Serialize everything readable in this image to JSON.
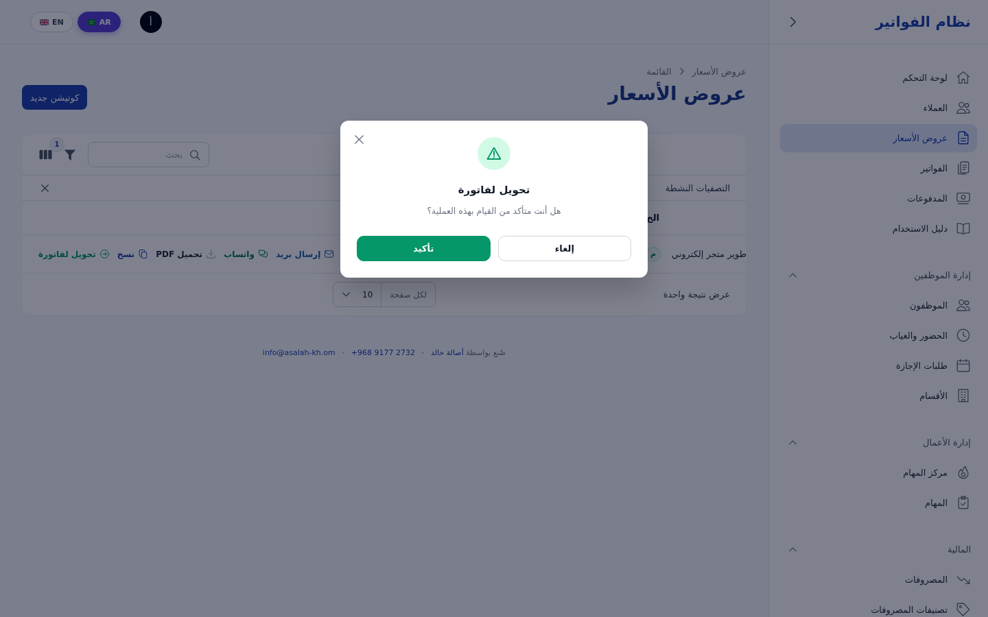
{
  "sidebar": {
    "logo": "نظام الفواتير",
    "nav": [
      {
        "label": "لوحة التحكم",
        "selected": false
      },
      {
        "label": "العملاء",
        "selected": false
      },
      {
        "label": "عروض الأسعار",
        "selected": true
      },
      {
        "label": "الفواتير",
        "selected": false
      },
      {
        "label": "المدفوعات",
        "selected": false
      },
      {
        "label": "دليل الاستخدام",
        "selected": false
      }
    ],
    "groups": [
      {
        "title": "إدارة الموظفين",
        "expanded": true,
        "items": [
          {
            "label": "الموظفون",
            "selected": false
          },
          {
            "label": "الحضور والغياب",
            "selected": false
          },
          {
            "label": "طلبات الإجازة",
            "selected": false
          },
          {
            "label": "الأقسام",
            "selected": false
          }
        ]
      },
      {
        "title": "إدارة الأعمال",
        "expanded": true,
        "items": [
          {
            "label": "مركز المهام",
            "selected": false
          },
          {
            "label": "المهام",
            "selected": false
          }
        ]
      },
      {
        "title": "المالية",
        "expanded": true,
        "items": [
          {
            "label": "المصروفات",
            "selected": false
          },
          {
            "label": "تصنيفات المصروفات",
            "selected": false
          }
        ]
      }
    ]
  },
  "header": {
    "avatar": "أ",
    "languages": [
      {
        "code": "AR",
        "selected": true
      },
      {
        "code": "EN",
        "selected": false
      }
    ]
  },
  "page": {
    "breadcrumb": [
      "عروض الأسعار",
      "القائمة"
    ],
    "title": "عروض الأسعار",
    "new_button": "كوتيشن جديد"
  },
  "table": {
    "search": {
      "placeholder": "بحث"
    },
    "filter_badge": "1",
    "active_filters": {
      "label": "التصفيات النشطة"
    },
    "header_row": {
      "column_2": "الح"
    },
    "rows": [
      {
        "column_1": "طوير متجر إلكتروني",
        "column_2": "م",
        "actions": [
          {
            "label": "إرسال بريد",
            "kind": "email"
          },
          {
            "label": "واتساب",
            "kind": "whatsapp"
          },
          {
            "label": "تحميل PDF",
            "kind": "pdf"
          },
          {
            "label": "نسخ",
            "kind": "copy"
          },
          {
            "label": "تحويل لفاتورة",
            "kind": "convert"
          }
        ]
      }
    ],
    "pagination": {
      "summary": "عرض نتيجة واحدة",
      "per_page_label": "لكل صفحة",
      "per_page": "10"
    }
  },
  "footer": {
    "credit": "صُنع بواسطة",
    "author": "أصالة خالد",
    "phone": "+968 9177 2732",
    "email": "info@asalah-kh.om"
  },
  "dialog": {
    "title": "تحويل لفاتورة",
    "message": "هل أنت متأكد من القيام بهذه العملية؟",
    "buttons": [
      {
        "label": "إلغاء",
        "kind": "cancel"
      },
      {
        "label": "تأكيد",
        "kind": "confirm"
      }
    ]
  }
}
